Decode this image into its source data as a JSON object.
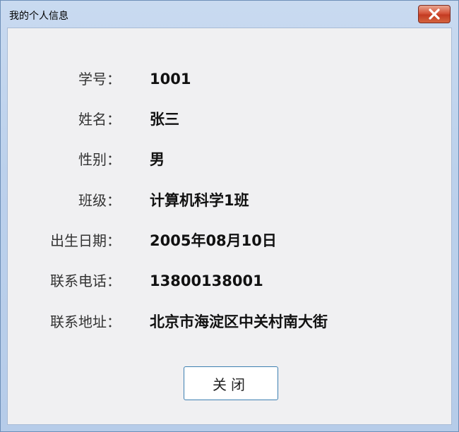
{
  "window": {
    "title": "我的个人信息"
  },
  "fields": [
    {
      "label": "学号：",
      "value": "1001"
    },
    {
      "label": "姓名：",
      "value": "张三"
    },
    {
      "label": "性别：",
      "value": "男"
    },
    {
      "label": "班级：",
      "value": "计算机科学1班"
    },
    {
      "label": "出生日期：",
      "value": "2005年08月10日"
    },
    {
      "label": "联系电话：",
      "value": "13800138001"
    },
    {
      "label": "联系地址：",
      "value": "北京市海淀区中关村南大街"
    }
  ],
  "buttons": {
    "close_label": "关闭"
  },
  "icons": {
    "titlebar_close": "close-icon"
  },
  "colors": {
    "close_button": "#c43b22",
    "dialog_button_border": "#3c7fb1",
    "client_background": "#f0f0f2"
  }
}
